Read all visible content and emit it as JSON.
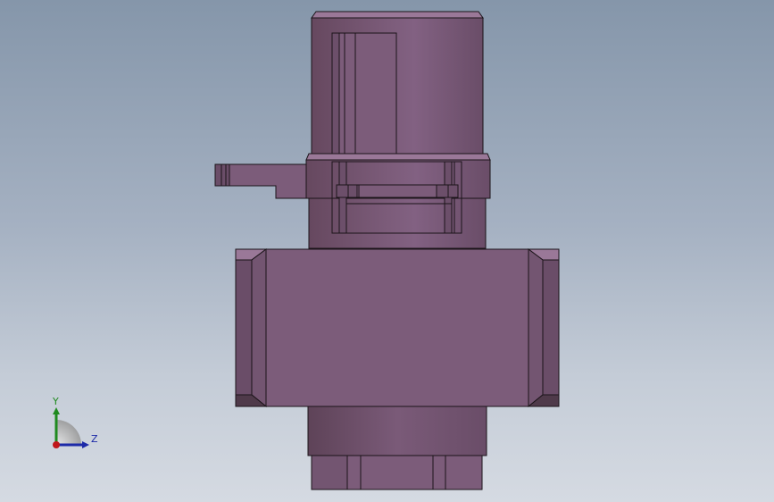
{
  "viewport": {
    "background_top": "#8596aa",
    "background_bottom": "#d5dae2"
  },
  "model": {
    "body_color": "#7c5c7a",
    "shade_dark": "#66485f",
    "shade_mid": "#6f5270",
    "highlight": "#8c6a8c",
    "top_face": "#9a7898",
    "edge_color": "#1b1419"
  },
  "triad": {
    "y_label": "Y",
    "z_label": "Z",
    "y_color": "#1f8a1f",
    "z_color": "#1d2aa8",
    "origin_color": "#c0161a",
    "x_icon": "x-axis-origin-icon"
  }
}
